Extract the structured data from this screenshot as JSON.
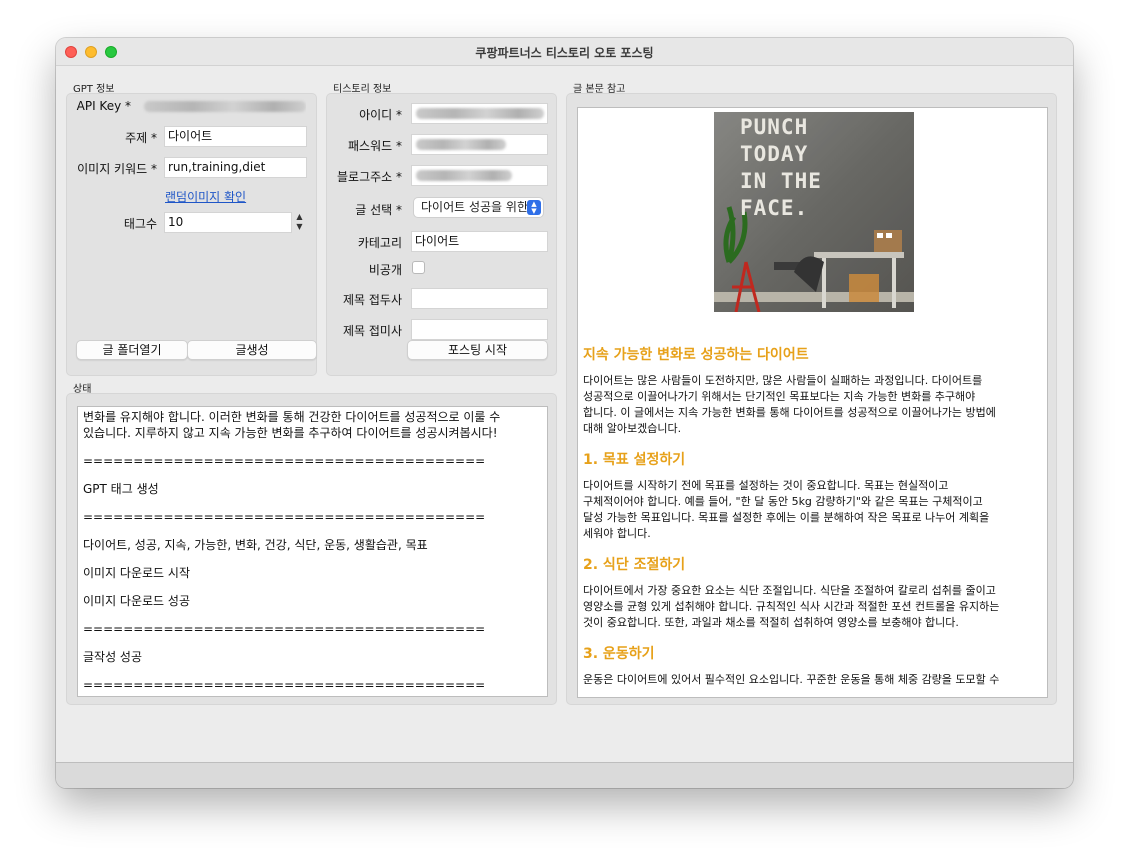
{
  "window": {
    "title": "쿠팡파트너스 티스토리 오토 포스팅"
  },
  "gpt": {
    "group_label": "GPT 정보",
    "api_key_label": "API Key *",
    "subject_label": "주제 *",
    "subject_value": "다이어트",
    "image_keyword_label": "이미지 키워드 *",
    "image_keyword_value": "run,training,diet",
    "random_image_link": "랜덤이미지 확인",
    "tag_count_label": "태그수",
    "tag_count_value": "10",
    "open_folder_button": "글 폴더열기",
    "generate_button": "글생성"
  },
  "tistory": {
    "group_label": "티스토리 정보",
    "id_label": "아이디 *",
    "password_label": "패스워드 *",
    "blog_address_label": "블로그주소 *",
    "post_select_label": "글 선택 *",
    "post_select_value": "다이어트 성공을 위한",
    "category_label": "카테고리",
    "category_value": "다이어트",
    "private_label": "비공개",
    "title_prefix_label": "제목 접두사",
    "title_suffix_label": "제목 접미사",
    "start_posting_button": "포스팅 시작"
  },
  "status": {
    "group_label": "상태",
    "log": [
      "변화를 유지해야 합니다. 이러한 변화를 통해 건강한 다이어트를 성공적으로 이룰 수\n있습니다. 지루하지 않고 지속 가능한 변화를 추구하여 다이어트를 성공시켜봅시다!",
      "========================================",
      "GPT 태그 생성",
      "========================================",
      "다이어트, 성공, 지속, 가능한, 변화, 건강, 식단, 운동, 생활습관, 목표",
      "이미지 다운로드 시작",
      "이미지 다운로드 성공",
      "========================================",
      "글작성 성공",
      "========================================"
    ]
  },
  "article": {
    "group_label": "글 본문 참고",
    "image_text": [
      "PUNCH",
      "TODAY",
      "IN THE",
      "FACE."
    ],
    "title": "지속 가능한 변화로 성공하는 다이어트",
    "intro": "다이어트는 많은 사람들이 도전하지만, 많은 사람들이 실패하는 과정입니다. 다이어트를\n성공적으로 이끌어나가기 위해서는 단기적인 목표보다는 지속 가능한 변화를 추구해야\n합니다. 이 글에서는 지속 가능한 변화를 통해 다이어트를 성공적으로 이끌어나가는 방법에\n대해 알아보겠습니다.",
    "sections": [
      {
        "heading": "1. 목표 설정하기",
        "body": "다이어트를 시작하기 전에 목표를 설정하는 것이 중요합니다. 목표는 현실적이고\n구체적이어야 합니다. 예를 들어, \"한 달 동안 5kg 감량하기\"와 같은 목표는 구체적이고\n달성 가능한 목표입니다. 목표를 설정한 후에는 이를 분해하여 작은 목표로 나누어 계획을\n세워야 합니다."
      },
      {
        "heading": "2. 식단 조절하기",
        "body": "다이어트에서 가장 중요한 요소는 식단 조절입니다. 식단을 조절하여 칼로리 섭취를 줄이고\n영양소를 균형 있게 섭취해야 합니다. 규칙적인 식사 시간과 적절한 포션 컨트롤을 유지하는\n것이 중요합니다. 또한, 과일과 채소를 적절히 섭취하여 영양소를 보충해야 합니다."
      },
      {
        "heading": "3. 운동하기",
        "body": "운동은 다이어트에 있어서 필수적인 요소입니다. 꾸준한 운동을 통해 체중 감량을 도모할 수"
      }
    ]
  }
}
